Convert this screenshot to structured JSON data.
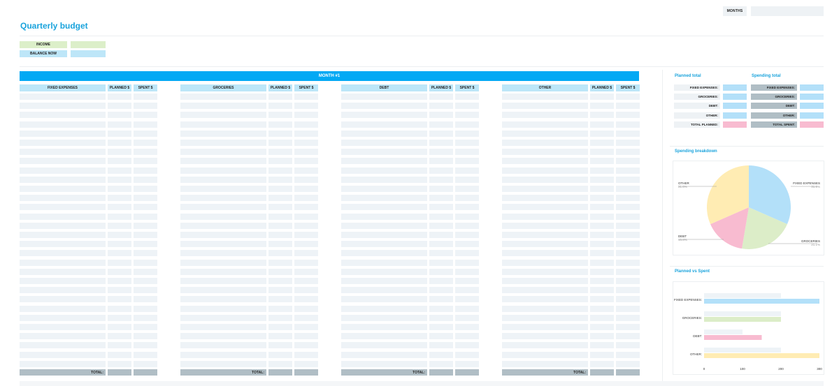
{
  "header": {
    "months_label": "MONTHS",
    "title": "Quarterly budget",
    "income_label": "INCOME",
    "balance_label": "BALANCE NOW"
  },
  "month": {
    "title": "MONTH #1",
    "tables": [
      {
        "name": "FIXED EXPENSES",
        "planned": "PLANNED $",
        "spent": "SPENT $",
        "total": "TOTAL:"
      },
      {
        "name": "GROCERIES",
        "planned": "PLANNED $",
        "spent": "SPENT $",
        "total": "TOTAL:"
      },
      {
        "name": "DEBT",
        "planned": "PLANNED $",
        "spent": "SPENT $",
        "total": "TOTAL:"
      },
      {
        "name": "OTHER",
        "planned": "PLANNED $",
        "spent": "SPENT $",
        "total": "TOTAL:"
      }
    ]
  },
  "planned_total": {
    "title": "Planned total",
    "rows": [
      "FIXED EXPENSES:",
      "GROCERIES:",
      "DEBT:",
      "OTHER:",
      "TOTAL PLANNED:"
    ]
  },
  "spending_total": {
    "title": "Spending total",
    "rows": [
      "FIXED EXPENSES:",
      "GROCERIES:",
      "DEBT:",
      "OTHER:",
      "TOTAL SPENT:"
    ]
  },
  "spending_breakdown": {
    "title": "Spending breakdown"
  },
  "planned_vs_spent": {
    "title": "Planned vs Spent"
  },
  "colors": {
    "accent": "#03a9f4",
    "title": "#1aa3dc",
    "fixed": "#b3e0f9",
    "groceries": "#dcedc8",
    "debt": "#f8bbd0",
    "other": "#ffecb3",
    "planned_bar": "#eef3f7",
    "total_gray": "#b0bec5"
  },
  "chart_data": [
    {
      "type": "pie",
      "title": "Spending breakdown",
      "categories": [
        "FIXED EXPENSES",
        "GROCERIES",
        "DEBT",
        "OTHER"
      ],
      "values": [
        31.6,
        21.1,
        15.8,
        31.6
      ],
      "labels": [
        "31.6%",
        "21.1%",
        "15.8%",
        "31.6%"
      ]
    },
    {
      "type": "bar",
      "title": "Planned vs Spent",
      "categories": [
        "FIXED EXPENSES:",
        "GROCERIES:",
        "DEBT:",
        "OTHER:"
      ],
      "series": [
        {
          "values": [
            200,
            200,
            100,
            200
          ]
        },
        {
          "values": [
            300,
            200,
            150,
            300
          ]
        }
      ],
      "xticks": [
        "0",
        "100",
        "200",
        "300"
      ],
      "xlim": [
        0,
        300
      ]
    }
  ]
}
